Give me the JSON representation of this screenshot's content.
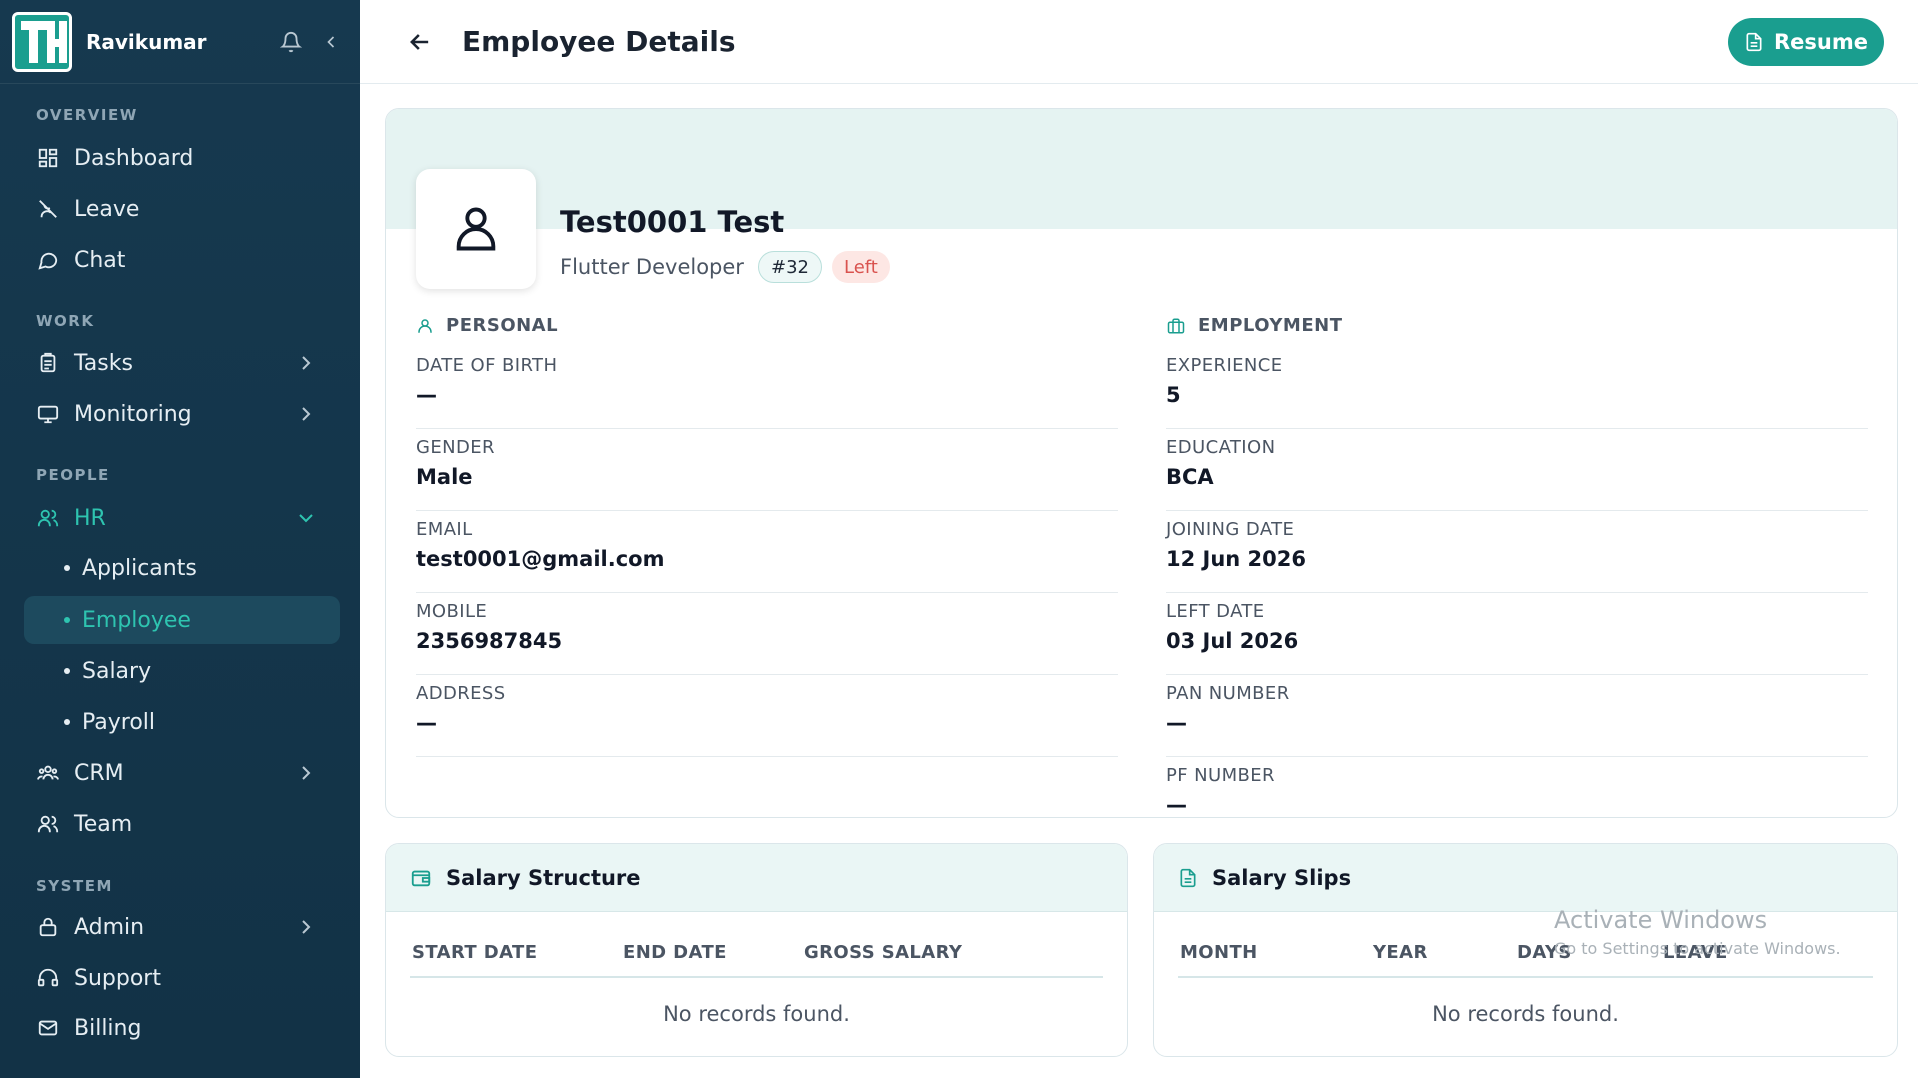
{
  "sidebar": {
    "user": "Ravikumar",
    "sections": {
      "overview": "OVERVIEW",
      "work": "WORK",
      "people": "PEOPLE",
      "system": "SYSTEM"
    },
    "items": {
      "dashboard": "Dashboard",
      "leave": "Leave",
      "chat": "Chat",
      "tasks": "Tasks",
      "monitoring": "Monitoring",
      "hr": "HR",
      "applicants": "Applicants",
      "employee": "Employee",
      "salary": "Salary",
      "payroll": "Payroll",
      "crm": "CRM",
      "team": "Team",
      "admin": "Admin",
      "support": "Support",
      "billing": "Billing"
    }
  },
  "header": {
    "title": "Employee Details",
    "resume_label": "Resume"
  },
  "profile": {
    "name": "Test0001 Test",
    "role": "Flutter Developer",
    "id_badge": "#32",
    "status_badge": "Left"
  },
  "personal": {
    "title": "PERSONAL",
    "fields": [
      {
        "label": "DATE OF BIRTH",
        "value": "—"
      },
      {
        "label": "GENDER",
        "value": "Male"
      },
      {
        "label": "EMAIL",
        "value": "test0001@gmail.com"
      },
      {
        "label": "MOBILE",
        "value": "2356987845"
      },
      {
        "label": "ADDRESS",
        "value": "—"
      }
    ]
  },
  "employment": {
    "title": "EMPLOYMENT",
    "fields": [
      {
        "label": "EXPERIENCE",
        "value": "5"
      },
      {
        "label": "EDUCATION",
        "value": "BCA"
      },
      {
        "label": "JOINING DATE",
        "value": "12 Jun 2026"
      },
      {
        "label": "LEFT DATE",
        "value": "03 Jul 2026"
      },
      {
        "label": "PAN NUMBER",
        "value": "—"
      },
      {
        "label": "PF NUMBER",
        "value": "—"
      }
    ]
  },
  "salary_structure": {
    "title": "Salary Structure",
    "columns": [
      "START DATE",
      "END DATE",
      "GROSS SALARY"
    ],
    "empty": "No records found."
  },
  "salary_slips": {
    "title": "Salary Slips",
    "columns": [
      "MONTH",
      "YEAR",
      "DAYS",
      "LEAVE"
    ],
    "empty": "No records found."
  },
  "watermark": {
    "line1": "Activate Windows",
    "line2": "Go to Settings to activate Windows."
  },
  "colors": {
    "accent": "#1a9e8f",
    "sidebar_bg": "#16394f",
    "active_text": "#2ec4b0",
    "left_badge": "#d9534f"
  }
}
